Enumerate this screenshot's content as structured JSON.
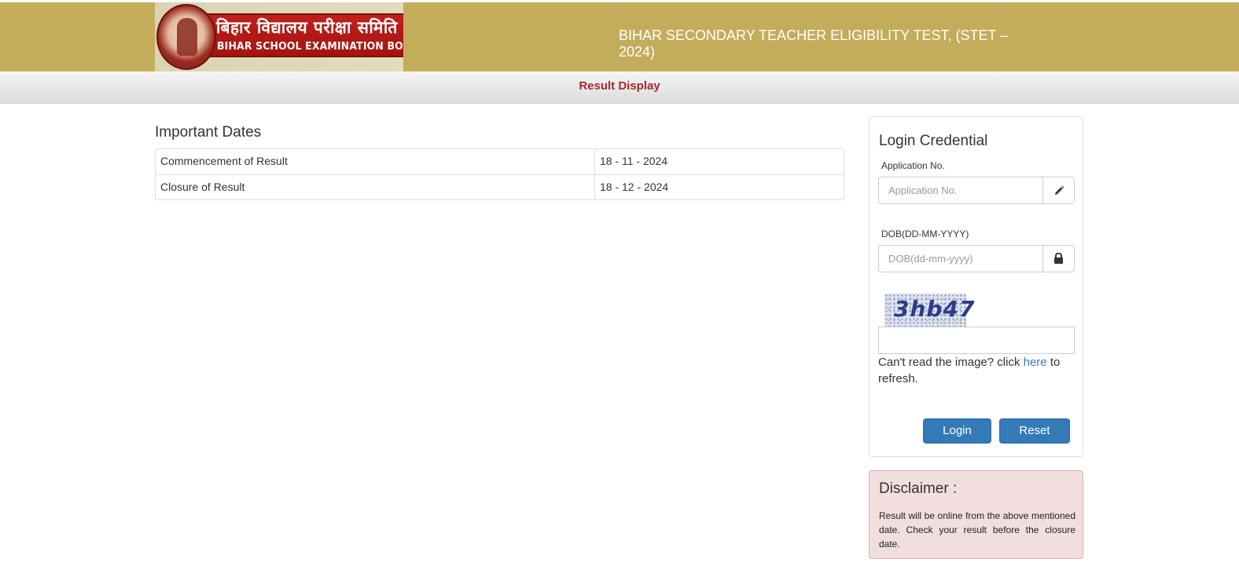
{
  "header": {
    "logo_hindi": "बिहार विद्यालय परीक्षा समिति",
    "logo_english": "BIHAR SCHOOL EXAMINATION BOARD",
    "title": "BIHAR SECONDARY TEACHER ELIGIBILITY TEST, (STET – 2024)"
  },
  "subbar": {
    "title": "Result Display"
  },
  "important_dates": {
    "heading": "Important Dates",
    "rows": [
      {
        "label": "Commencement of Result",
        "value": "18 - 11 - 2024"
      },
      {
        "label": "Closure of Result",
        "value": "18 - 12 - 2024"
      }
    ]
  },
  "login": {
    "title": "Login Credential",
    "application": {
      "label": "Application No.",
      "placeholder": "Application No.",
      "icon": "pencil-icon"
    },
    "dob": {
      "label": "DOB(DD-MM-YYYY)",
      "placeholder": "DOB(dd-mm-yyyy)",
      "icon": "lock-icon"
    },
    "captcha": {
      "text": "3hb47",
      "help_prefix": "Can't read the image? click ",
      "help_link": "here",
      "help_suffix": " to refresh."
    },
    "login_button": "Login",
    "reset_button": "Reset",
    "button_color": "#337ab7"
  },
  "disclaimer": {
    "title": "Disclaimer :",
    "text": "Result will be online from the above mentioned date. Check your result before the closure date."
  },
  "colors": {
    "header_bg": "#c3ad5b",
    "subbar_title": "#a52a2a",
    "disclaimer_bg": "#f2dede"
  }
}
